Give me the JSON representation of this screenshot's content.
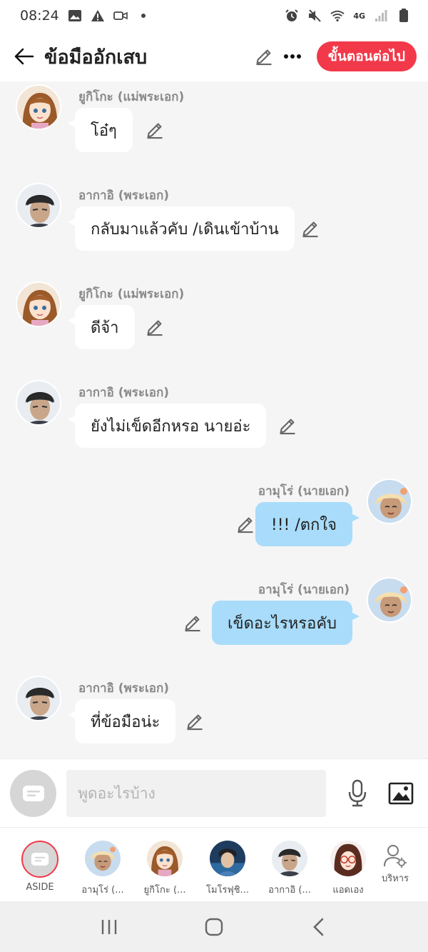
{
  "status_bar": {
    "time": "08:24",
    "network": "4G"
  },
  "header": {
    "title": "ข้อมืออักเสบ",
    "next_step_label": "ขั้นตอนต่อไป"
  },
  "messages": [
    {
      "sender": "ยูกิโกะ (แม่พระเอก)",
      "text": "โอ๋ๆ",
      "side": "left",
      "avatar": "yukiko"
    },
    {
      "sender": "อากาอิ (พระเอก)",
      "text": "กลับมาแล้วคับ /เดินเข้าบ้าน",
      "side": "left",
      "avatar": "akai"
    },
    {
      "sender": "ยูกิโกะ (แม่พระเอก)",
      "text": "ดีจ้า",
      "side": "left",
      "avatar": "yukiko"
    },
    {
      "sender": "อากาอิ (พระเอก)",
      "text": "ยังไม่เข็ดอีกหรอ นายอ่ะ",
      "side": "left",
      "avatar": "akai"
    },
    {
      "sender": "อามุโร่ (นายเอก)",
      "text": "!!! /ตกใจ",
      "side": "right",
      "avatar": "amuro"
    },
    {
      "sender": "อามุโร่ (นายเอก)",
      "text": "เข็ดอะไรหรอคับ",
      "side": "right",
      "avatar": "amuro"
    },
    {
      "sender": "อากาอิ (พระเอก)",
      "text": "ที่ข้อมือน่ะ",
      "side": "left",
      "avatar": "akai"
    }
  ],
  "input": {
    "placeholder": "พูดอะไรบ้าง"
  },
  "characters": [
    {
      "label": "ASIDE",
      "avatar": "aside"
    },
    {
      "label": "อามุโร่ (...",
      "avatar": "amuro"
    },
    {
      "label": "ยูกิโกะ (...",
      "avatar": "yukiko"
    },
    {
      "label": "โมโรฟุชิ...",
      "avatar": "morofushi"
    },
    {
      "label": "อากาอิ (...",
      "avatar": "akai"
    },
    {
      "label": "แอดเอง",
      "avatar": "admin"
    }
  ],
  "manage_label": "บริหาร",
  "colors": {
    "accent": "#f2394a",
    "bubble_left": "#ffffff",
    "bubble_right": "#a8dcfa",
    "background": "#f5f5f5"
  }
}
